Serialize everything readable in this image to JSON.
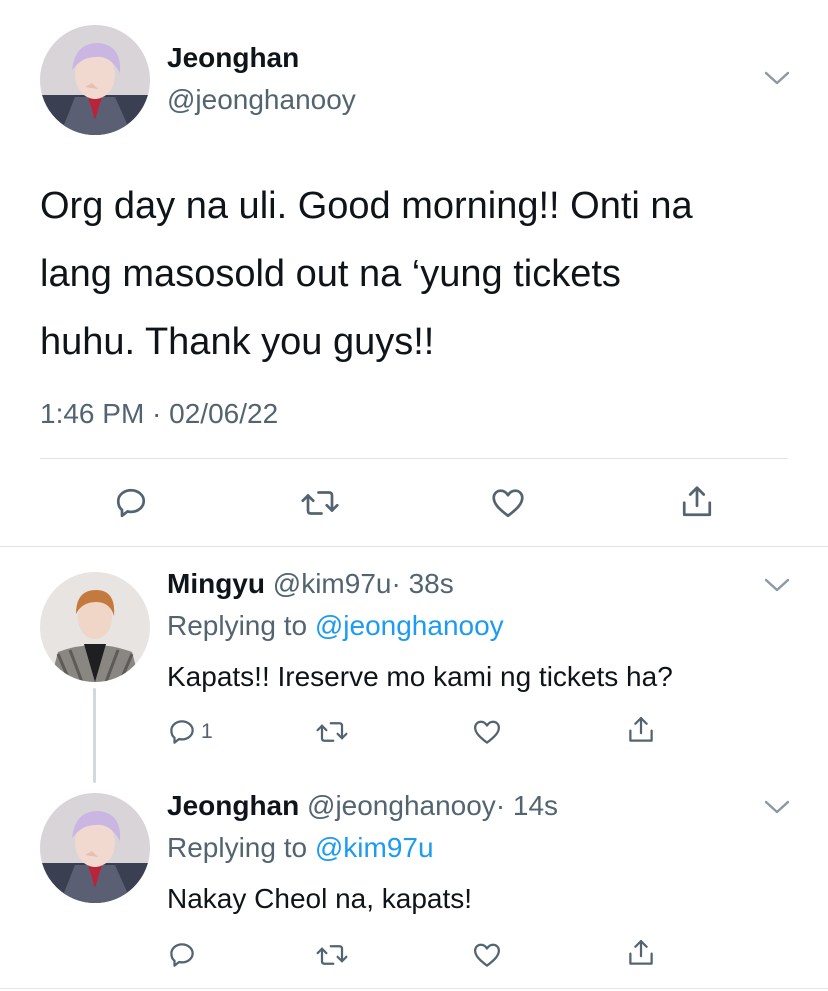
{
  "main_tweet": {
    "author_name": "Jeonghan",
    "author_handle": "@jeonghanooy",
    "text_line1": "Org day na uli. Good morning!! Onti na",
    "text_line2": "lang masosold out na ‘yung tickets",
    "text_line3": "huhu. Thank you guys!!",
    "timestamp": "1:46 PM · 02/06/22"
  },
  "replies": [
    {
      "author_name": "Mingyu",
      "author_handle": "@kim97u",
      "age": "· 38s",
      "replying_prefix": "Replying to",
      "replying_to": "@jeonghanooy",
      "text": "Kapats!! Ireserve mo kami ng tickets ha?",
      "reply_count": "1"
    },
    {
      "author_name": "Jeonghan",
      "author_handle": "@jeonghanooy",
      "age": "· 14s",
      "replying_prefix": "Replying to",
      "replying_to": "@kim97u",
      "text": "Nakay Cheol na, kapats!"
    }
  ],
  "icons": {
    "reply": "reply-icon",
    "retweet": "retweet-icon",
    "like": "heart-icon",
    "share": "share-icon",
    "more": "chevron-down-icon"
  },
  "colors": {
    "text": "#0f1419",
    "secondary": "#536471",
    "link": "#1d9bf0",
    "divider": "#e1e5e9",
    "thread_line": "#cfd9de"
  }
}
